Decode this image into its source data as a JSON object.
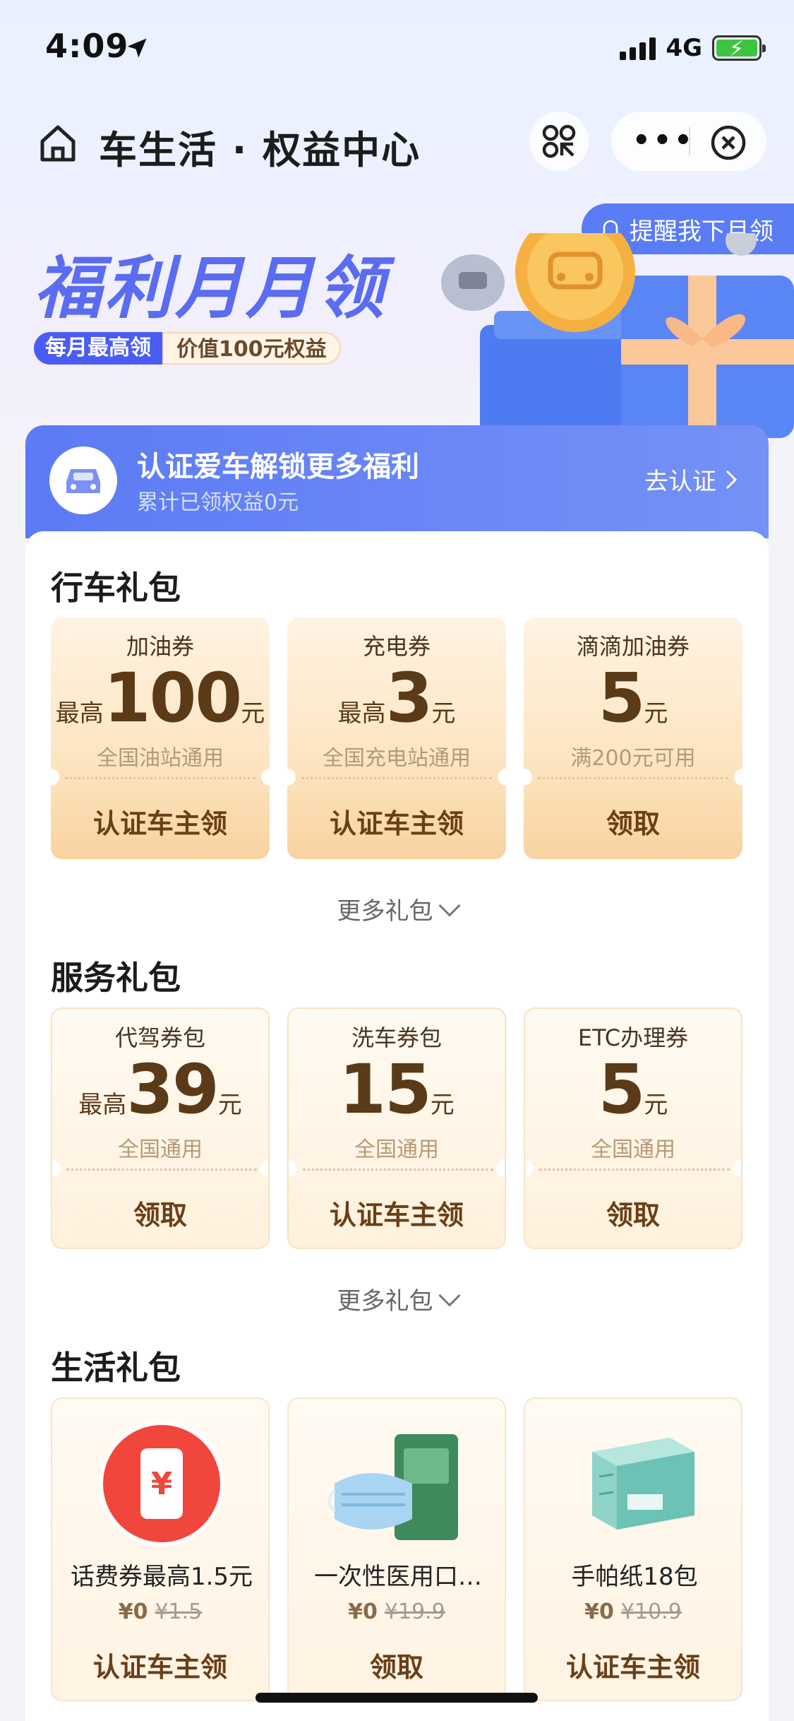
{
  "status_bar": {
    "time": "4:09",
    "network": "4G"
  },
  "nav": {
    "title": "车生活 · 权益中心"
  },
  "banner": {
    "title": "福利月月领",
    "tag": "每月最高领",
    "value": "价值100元权益",
    "remind_label": "提醒我下月领"
  },
  "certify": {
    "title": "认证爱车解锁更多福利",
    "subtitle": "累计已领权益0元",
    "button": "去认证"
  },
  "driving": {
    "title": "行车礼包",
    "coupons": [
      {
        "name": "加油券",
        "prefix": "最高",
        "amount": "100",
        "unit": "元",
        "desc": "全国油站通用",
        "action": "认证车主领"
      },
      {
        "name": "充电券",
        "prefix": "最高",
        "amount": "3",
        "unit": "元",
        "desc": "全国充电站通用",
        "action": "认证车主领"
      },
      {
        "name": "滴滴加油券",
        "prefix": "",
        "amount": "5",
        "unit": "元",
        "desc": "满200元可用",
        "action": "领取"
      }
    ],
    "more": "更多礼包"
  },
  "service": {
    "title": "服务礼包",
    "coupons": [
      {
        "name": "代驾券包",
        "prefix": "最高",
        "amount": "39",
        "unit": "元",
        "desc": "全国通用",
        "action": "领取"
      },
      {
        "name": "洗车券包",
        "prefix": "",
        "amount": "15",
        "unit": "元",
        "desc": "全国通用",
        "action": "认证车主领"
      },
      {
        "name": "ETC办理券",
        "prefix": "",
        "amount": "5",
        "unit": "元",
        "desc": "全国通用",
        "action": "领取"
      }
    ],
    "more": "更多礼包"
  },
  "life": {
    "title": "生活礼包",
    "products": [
      {
        "name": "话费券最高1.5元",
        "price": "¥0",
        "original": "¥1.5",
        "action": "认证车主领",
        "icon": "phone-bill-icon"
      },
      {
        "name": "一次性医用口…",
        "price": "¥0",
        "original": "¥19.9",
        "action": "领取",
        "icon": "face-mask-icon"
      },
      {
        "name": "手帕纸18包",
        "price": "¥0",
        "original": "¥10.9",
        "action": "认证车主领",
        "icon": "tissue-box-icon"
      }
    ]
  },
  "colors": {
    "brand_blue": "#5c7bf4",
    "coupon_brown": "#5b3a18",
    "accent_red": "#f0463c"
  }
}
